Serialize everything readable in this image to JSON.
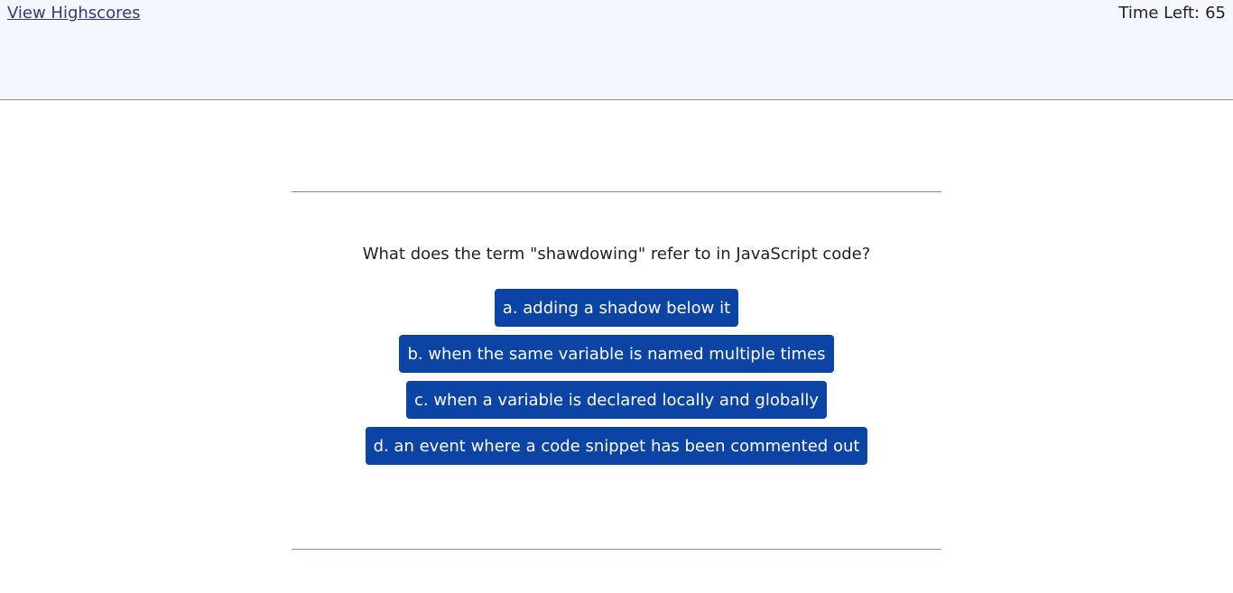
{
  "header": {
    "highscores_link": "View Highscores",
    "timer_label": "Time Left:",
    "timer_value": "65"
  },
  "quiz": {
    "question": "What does the term \"shawdowing\" refer to in JavaScript code?",
    "choices": [
      "a. adding a shadow below it",
      "b. when the same variable is named multiple times",
      "c. when a variable is declared locally and globally",
      "d. an event where a code snippet has been commented out"
    ]
  },
  "colors": {
    "header_bg": "#f4f7ff",
    "button_bg": "#0b44a4",
    "link": "#2f3e78"
  }
}
